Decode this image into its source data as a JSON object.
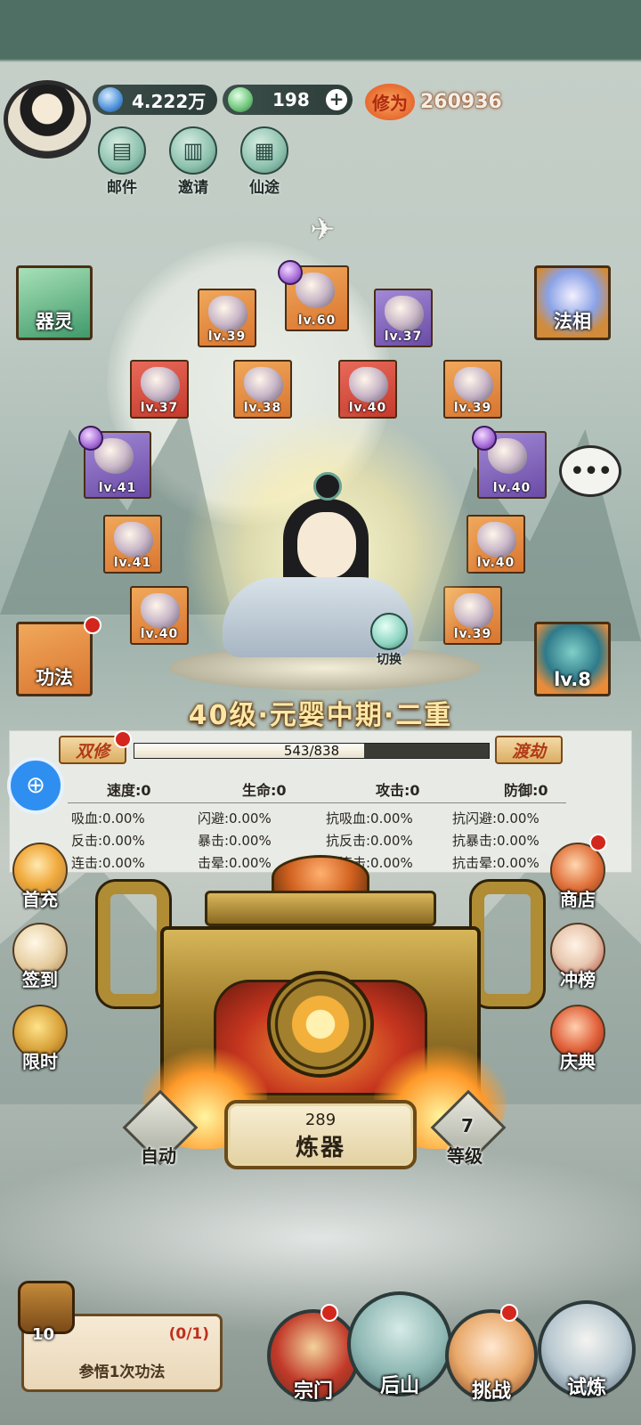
{
  "header": {
    "spirit_stones": "4.222万",
    "jade": "198",
    "cultivation_label": "修为",
    "cultivation_value": "260936"
  },
  "menu": [
    {
      "label": "邮件",
      "icon": "mail-icon"
    },
    {
      "label": "邀请",
      "icon": "invite-icon"
    },
    {
      "label": "仙途",
      "icon": "journey-icon"
    }
  ],
  "side_cards": {
    "qiling": "器灵",
    "faxiang": "法相",
    "gongfa": "功法",
    "pet_level": "lv.8"
  },
  "equipment": [
    {
      "level": "lv.39",
      "color": "orange"
    },
    {
      "level": "lv.60",
      "color": "orange"
    },
    {
      "level": "lv.37",
      "color": "purple"
    },
    {
      "level": "lv.37",
      "color": "red"
    },
    {
      "level": "lv.38",
      "color": "orange"
    },
    {
      "level": "lv.40",
      "color": "red"
    },
    {
      "level": "lv.39",
      "color": "orange"
    },
    {
      "level": "lv.41",
      "color": "purple"
    },
    {
      "level": "lv.40",
      "color": "purple"
    },
    {
      "level": "lv.41",
      "color": "orange"
    },
    {
      "level": "lv.40",
      "color": "orange"
    },
    {
      "level": "lv.40",
      "color": "purple"
    },
    {
      "level": "lv.39",
      "color": "purple"
    }
  ],
  "character": {
    "switch_label": "切换",
    "realm": "40级·元婴中期·二重"
  },
  "progress": {
    "left_button": "双修",
    "right_button": "渡劫",
    "current": 543,
    "max": 838,
    "text": "543/838"
  },
  "stats_main": [
    "速度:0",
    "生命:0",
    "攻击:0",
    "防御:0"
  ],
  "stats_rows": [
    [
      "吸血:0.00%",
      "闪避:0.00%",
      "抗吸血:0.00%",
      "抗闪避:0.00%"
    ],
    [
      "反击:0.00%",
      "暴击:0.00%",
      "抗反击:0.00%",
      "抗暴击:0.00%"
    ],
    [
      "连击:0.00%",
      "击晕:0.00%",
      "抗连击:0.00%",
      "抗击晕:0.00%"
    ]
  ],
  "left_buttons": [
    "首充",
    "签到",
    "限时"
  ],
  "right_buttons": [
    "商店",
    "冲榜",
    "庆典"
  ],
  "forge": {
    "count": "289",
    "label": "炼器",
    "auto_label": "自动",
    "level_num": "7",
    "level_label": "等级"
  },
  "quest": {
    "chest_count": "10",
    "progress": "(0/1)",
    "text": "参悟1次功法"
  },
  "bottom_nav": [
    "宗门",
    "后山",
    "挑战",
    "试炼"
  ]
}
